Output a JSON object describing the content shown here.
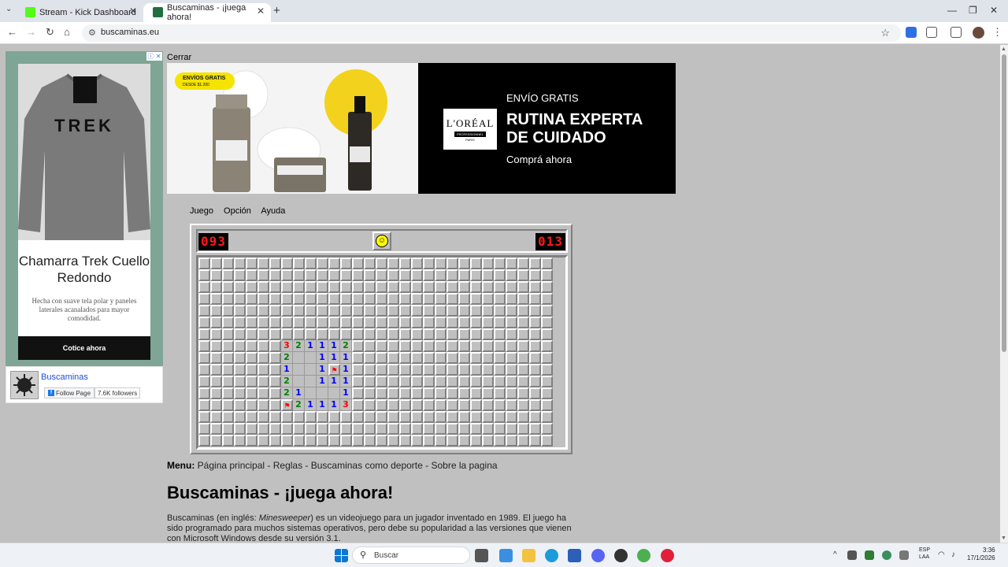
{
  "browser": {
    "tabs": [
      {
        "label": "Stream - Kick Dashboard",
        "color": "#53fc18"
      },
      {
        "label": "Buscaminas - ¡juega ahora!",
        "color": "#1f6f3f"
      }
    ],
    "new_tab_glyph": "+",
    "url": "buscaminas.eu"
  },
  "left_ad": {
    "brand_on_sweater": "TREK",
    "title": "Chamarra Trek Cuello Redondo",
    "description": "Hecha con suave tela polar y paneles laterales acanalados para mayor comodidad.",
    "button": "Cotice ahora"
  },
  "fb_widget": {
    "name": "Buscaminas",
    "follow": "Follow Page",
    "followers": "7.6K followers"
  },
  "close_label": "Cerrar",
  "banner": {
    "badge": "ENVÍOS GRATIS",
    "badge_sub": "DESDE $1.200",
    "logo": "L'ORÉAL",
    "logo_sub": "PROFESSIONNEL",
    "logo_city": "PARIS",
    "line1": "ENVÍO GRATIS",
    "line2": "RUTINA EXPERTA DE CUIDADO",
    "line3": "Comprá ahora"
  },
  "game": {
    "menu": [
      "Juego",
      "Opción",
      "Ayuda"
    ],
    "mines_left": "093",
    "timer": "013",
    "cols": 30,
    "rows": 16,
    "revealed": {
      "7": [
        null,
        null,
        null,
        null,
        null,
        null,
        null,
        "3",
        "2",
        "1",
        "1",
        "1",
        "2"
      ],
      "8": [
        null,
        null,
        null,
        null,
        null,
        null,
        null,
        "2",
        "",
        "",
        "1",
        "1",
        "1"
      ],
      "9": [
        null,
        null,
        null,
        null,
        null,
        null,
        null,
        "1",
        "",
        "",
        "1",
        "F",
        "1"
      ],
      "10": [
        null,
        null,
        null,
        null,
        null,
        null,
        null,
        "2",
        "",
        "",
        "1",
        "1",
        "1"
      ],
      "11": [
        null,
        null,
        null,
        null,
        null,
        null,
        null,
        "2",
        "1",
        "",
        "",
        "",
        "1"
      ],
      "12": [
        null,
        null,
        null,
        null,
        null,
        null,
        null,
        "F",
        "2",
        "1",
        "1",
        "1",
        "3"
      ]
    }
  },
  "content": {
    "menu_label": "Menu:",
    "menu_links": "Página principal - Reglas - Buscaminas como deporte - Sobre la pagina",
    "headline": "Buscaminas - ¡juega ahora!",
    "para_a": "Buscaminas (en inglés: ",
    "para_b": "Minesweeper",
    "para_c": ") es un videojuego para un jugador inventado en 1989. El juego ha sido programado para muchos sistemas operativos, pero debe su popularidad a las versiones que vienen con Microsoft Windows desde su versión 3.1."
  },
  "taskbar": {
    "search": "Buscar",
    "lang_top": "ESP",
    "lang_bottom": "LAA",
    "time": "3:36",
    "date": "17/1/2026"
  }
}
